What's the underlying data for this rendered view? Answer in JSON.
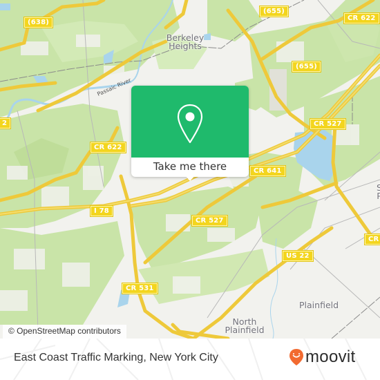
{
  "map": {
    "colors": {
      "background": "#f2f2ee",
      "park": "#c9e4a8",
      "water": "#a9d4ec",
      "road_major": "#f3d51e",
      "rail": "#8a8a8a"
    },
    "road_shields": [
      {
        "label": "(638)"
      },
      {
        "label": "(655)"
      },
      {
        "label": "CR 622"
      },
      {
        "label": "(655)"
      },
      {
        "label": "2"
      },
      {
        "label": "CR 622"
      },
      {
        "label": "CR 527"
      },
      {
        "label": "CR 641"
      },
      {
        "label": "I 78"
      },
      {
        "label": "CR 527"
      },
      {
        "label": "CR"
      },
      {
        "label": "US 22"
      },
      {
        "label": "CR 531"
      }
    ],
    "places": [
      {
        "name": "Berkeley Heights"
      },
      {
        "name": "Plainfield"
      },
      {
        "name": "North Plainfield"
      },
      {
        "name": "S P"
      }
    ],
    "rivers": [
      {
        "name": "Passaic River"
      }
    ],
    "attribution": "© OpenStreetMap contributors"
  },
  "popup": {
    "icon": "map-pin-icon",
    "accent_color": "#1fba6c",
    "cta_label": "Take me there"
  },
  "footer": {
    "title": "East Coast Traffic Marking, New York City",
    "brand": "moovit",
    "brand_color": "#f26a30"
  }
}
